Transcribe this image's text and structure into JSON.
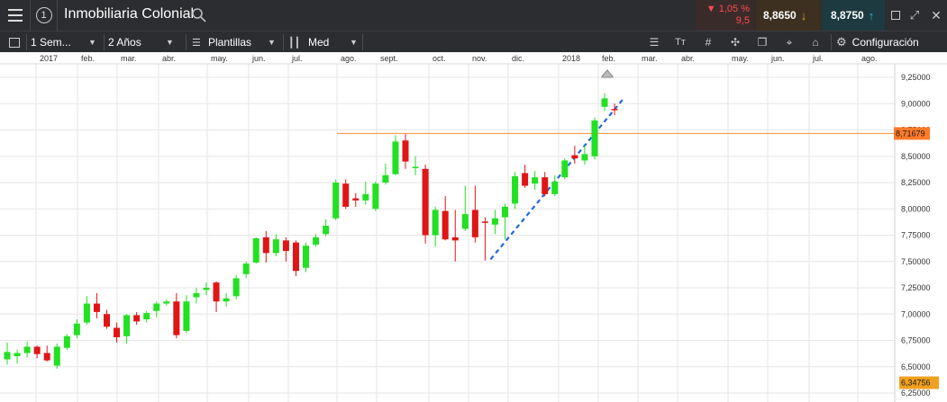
{
  "header": {
    "title": "Inmobiliaria Colonial",
    "change_pct": "▼ 1,05 %",
    "change_abs": "9,5",
    "bid": "8,8650",
    "ask": "8,8750",
    "info_icon": "ⓘ"
  },
  "toolbar": {
    "period": "1 Sem...",
    "range": "2 Años",
    "templates": "Plantillas",
    "indicator": "Med",
    "config": "Configuración"
  },
  "colors": {
    "up": "#22e022",
    "down": "#e01515",
    "bid_bg": "#8a5a1a",
    "ask_bg": "#1a4a5a",
    "change": "#ff4a4a",
    "resistance": "#ff8c2a",
    "trend": "#2266dd"
  },
  "chart_data": {
    "type": "candlestick",
    "x_labels": [
      "2017",
      "feb.",
      "mar.",
      "abr.",
      "may.",
      "jun.",
      "jul.",
      "ago.",
      "sept.",
      "oct.",
      "nov.",
      "dic.",
      "2018",
      "feb.",
      "mar.",
      "abr.",
      "may.",
      "jun.",
      "jul.",
      "ago."
    ],
    "y_ticks": [
      "9,25000",
      "9,00000",
      "8,75000",
      "8,50000",
      "8,25000",
      "8,00000",
      "7,75000",
      "7,50000",
      "7,25000",
      "7,00000",
      "6,75000",
      "6,50000",
      "6,25000"
    ],
    "ylim": [
      6.25,
      9.35
    ],
    "candles": [
      {
        "o": 6.57,
        "h": 6.73,
        "l": 6.52,
        "c": 6.64
      },
      {
        "o": 6.6,
        "h": 6.66,
        "l": 6.53,
        "c": 6.63
      },
      {
        "o": 6.63,
        "h": 6.74,
        "l": 6.59,
        "c": 6.69
      },
      {
        "o": 6.69,
        "h": 6.7,
        "l": 6.58,
        "c": 6.62
      },
      {
        "o": 6.63,
        "h": 6.7,
        "l": 6.55,
        "c": 6.56
      },
      {
        "o": 6.51,
        "h": 6.72,
        "l": 6.48,
        "c": 6.69
      },
      {
        "o": 6.68,
        "h": 6.81,
        "l": 6.66,
        "c": 6.79
      },
      {
        "o": 6.8,
        "h": 6.95,
        "l": 6.77,
        "c": 6.91
      },
      {
        "o": 6.92,
        "h": 7.17,
        "l": 6.9,
        "c": 7.1
      },
      {
        "o": 7.1,
        "h": 7.2,
        "l": 6.96,
        "c": 7.02
      },
      {
        "o": 7.0,
        "h": 7.04,
        "l": 6.86,
        "c": 6.88
      },
      {
        "o": 6.87,
        "h": 6.92,
        "l": 6.73,
        "c": 6.78
      },
      {
        "o": 6.79,
        "h": 7.0,
        "l": 6.72,
        "c": 6.99
      },
      {
        "o": 6.99,
        "h": 7.02,
        "l": 6.9,
        "c": 6.93
      },
      {
        "o": 6.95,
        "h": 7.03,
        "l": 6.92,
        "c": 7.01
      },
      {
        "o": 7.03,
        "h": 7.12,
        "l": 6.97,
        "c": 7.1
      },
      {
        "o": 7.1,
        "h": 7.14,
        "l": 7.08,
        "c": 7.12
      },
      {
        "o": 7.12,
        "h": 7.2,
        "l": 6.77,
        "c": 6.8
      },
      {
        "o": 6.84,
        "h": 7.18,
        "l": 6.82,
        "c": 7.12
      },
      {
        "o": 7.16,
        "h": 7.25,
        "l": 7.1,
        "c": 7.2
      },
      {
        "o": 7.23,
        "h": 7.3,
        "l": 7.18,
        "c": 7.25
      },
      {
        "o": 7.3,
        "h": 7.31,
        "l": 7.02,
        "c": 7.12
      },
      {
        "o": 7.12,
        "h": 7.2,
        "l": 7.07,
        "c": 7.15
      },
      {
        "o": 7.17,
        "h": 7.37,
        "l": 7.14,
        "c": 7.34
      },
      {
        "o": 7.38,
        "h": 7.5,
        "l": 7.34,
        "c": 7.48
      },
      {
        "o": 7.49,
        "h": 7.73,
        "l": 7.48,
        "c": 7.72
      },
      {
        "o": 7.73,
        "h": 7.79,
        "l": 7.49,
        "c": 7.58
      },
      {
        "o": 7.58,
        "h": 7.76,
        "l": 7.55,
        "c": 7.71
      },
      {
        "o": 7.7,
        "h": 7.73,
        "l": 7.5,
        "c": 7.6
      },
      {
        "o": 7.68,
        "h": 7.7,
        "l": 7.36,
        "c": 7.41
      },
      {
        "o": 7.44,
        "h": 7.68,
        "l": 7.4,
        "c": 7.65
      },
      {
        "o": 7.66,
        "h": 7.76,
        "l": 7.64,
        "c": 7.73
      },
      {
        "o": 7.76,
        "h": 7.9,
        "l": 7.74,
        "c": 7.84
      },
      {
        "o": 7.91,
        "h": 8.28,
        "l": 7.89,
        "c": 8.25
      },
      {
        "o": 8.24,
        "h": 8.28,
        "l": 8.0,
        "c": 8.02
      },
      {
        "o": 8.1,
        "h": 8.15,
        "l": 8.02,
        "c": 8.08
      },
      {
        "o": 8.08,
        "h": 8.26,
        "l": 8.04,
        "c": 8.14
      },
      {
        "o": 8.0,
        "h": 8.26,
        "l": 7.98,
        "c": 8.24
      },
      {
        "o": 8.25,
        "h": 8.43,
        "l": 8.23,
        "c": 8.32
      },
      {
        "o": 8.33,
        "h": 8.7,
        "l": 8.32,
        "c": 8.64
      },
      {
        "o": 8.65,
        "h": 8.71,
        "l": 8.38,
        "c": 8.45
      },
      {
        "o": 8.4,
        "h": 8.5,
        "l": 8.32,
        "c": 8.4
      },
      {
        "o": 8.38,
        "h": 8.42,
        "l": 7.67,
        "c": 7.75
      },
      {
        "o": 7.75,
        "h": 8.02,
        "l": 7.64,
        "c": 7.99
      },
      {
        "o": 7.98,
        "h": 8.12,
        "l": 7.7,
        "c": 7.71
      },
      {
        "o": 7.73,
        "h": 7.99,
        "l": 7.5,
        "c": 7.7
      },
      {
        "o": 7.81,
        "h": 8.22,
        "l": 7.79,
        "c": 7.95
      },
      {
        "o": 7.99,
        "h": 8.22,
        "l": 7.68,
        "c": 7.73
      },
      {
        "o": 7.88,
        "h": 7.92,
        "l": 7.51,
        "c": 7.87
      },
      {
        "o": 7.85,
        "h": 7.99,
        "l": 7.76,
        "c": 7.91
      },
      {
        "o": 7.92,
        "h": 8.05,
        "l": 7.71,
        "c": 8.02
      },
      {
        "o": 8.05,
        "h": 8.35,
        "l": 8.0,
        "c": 8.31
      },
      {
        "o": 8.34,
        "h": 8.42,
        "l": 8.2,
        "c": 8.22
      },
      {
        "o": 8.24,
        "h": 8.36,
        "l": 8.18,
        "c": 8.3
      },
      {
        "o": 8.3,
        "h": 8.35,
        "l": 8.12,
        "c": 8.14
      },
      {
        "o": 8.14,
        "h": 8.32,
        "l": 8.12,
        "c": 8.26
      },
      {
        "o": 8.3,
        "h": 8.48,
        "l": 8.28,
        "c": 8.46
      },
      {
        "o": 8.51,
        "h": 8.6,
        "l": 8.43,
        "c": 8.48
      },
      {
        "o": 8.46,
        "h": 8.6,
        "l": 8.42,
        "c": 8.52
      },
      {
        "o": 8.5,
        "h": 8.87,
        "l": 8.47,
        "c": 8.84
      },
      {
        "o": 8.97,
        "h": 9.1,
        "l": 8.93,
        "c": 9.05
      },
      {
        "o": 8.95,
        "h": 9.0,
        "l": 8.89,
        "c": 8.94
      }
    ],
    "resistance_level": 8.7167,
    "resistance_label": "8,71679",
    "current_low_label": "6,34756",
    "trendline": {
      "from": [
        8.22,
        7.52
      ],
      "to": [
        8.5,
        9.05
      ]
    }
  }
}
